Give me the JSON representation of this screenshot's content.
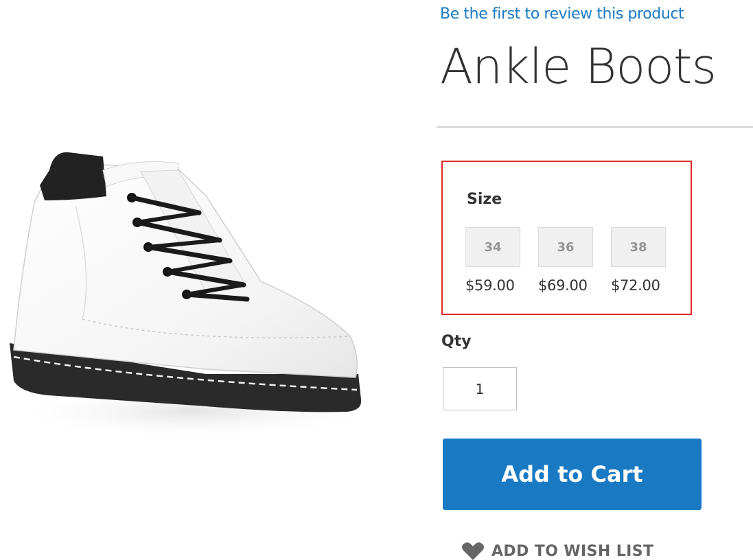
{
  "product": {
    "review_link": "Be the first to review this product",
    "title": "Ankle Boots",
    "image": {
      "alt": "white-leather-ankle-boot"
    }
  },
  "options": {
    "label": "Size",
    "swatches": [
      {
        "label": "34",
        "price": "$59.00"
      },
      {
        "label": "36",
        "price": "$69.00"
      },
      {
        "label": "38",
        "price": "$72.00"
      }
    ]
  },
  "qty": {
    "label": "Qty",
    "value": "1"
  },
  "actions": {
    "add_to_cart": "Add to Cart",
    "wishlist": "ADD TO WISH LIST",
    "wishlist_icon": "heart-icon"
  },
  "colors": {
    "accent": "#1979c3",
    "option_border": "#e02b27"
  }
}
